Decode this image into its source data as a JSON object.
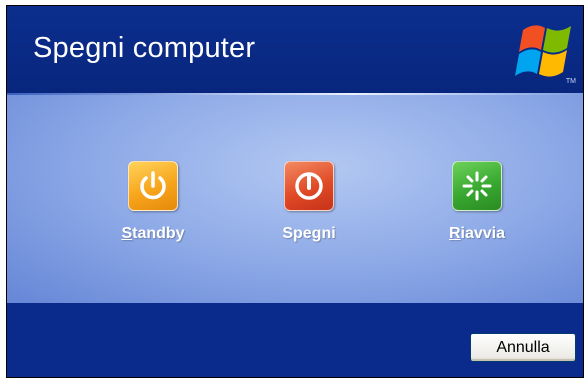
{
  "dialog": {
    "title": "Spegni computer",
    "logo_mark": "TM"
  },
  "options": [
    {
      "id": "standby",
      "label_prefix": "",
      "label_accel": "S",
      "label_rest": "tandby",
      "icon": "power-icon",
      "color": "#f7a51c"
    },
    {
      "id": "spegni",
      "label_prefix": "Spe",
      "label_accel": "g",
      "label_rest": "ni",
      "icon": "power-off-icon",
      "color": "#e04a26"
    },
    {
      "id": "riavvia",
      "label_prefix": "",
      "label_accel": "R",
      "label_rest": "iavvia",
      "icon": "restart-icon",
      "color": "#38a830"
    }
  ],
  "footer": {
    "cancel_label": "Annulla"
  }
}
